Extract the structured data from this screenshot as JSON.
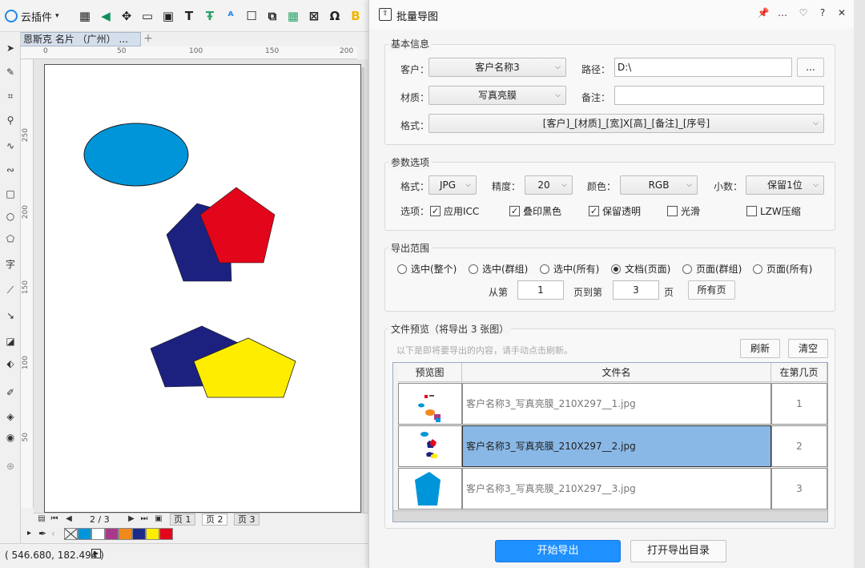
{
  "app": {
    "plugin_label": "云插件",
    "doc_tab": "恩斯克 名片 （广州） ...",
    "add_tab": "+",
    "toolbar_icons": [
      "k-logo-icon",
      "node-icon",
      "frame-icon",
      "image-icon",
      "text-tool-icon",
      "text-fit-icon",
      "figure-icon",
      "rectangle-icon",
      "copy-icon",
      "grid-icon",
      "image-edit-icon",
      "search-icon",
      "brand-icon"
    ],
    "ruler_h": [
      "0",
      "50",
      "100",
      "150",
      "200"
    ],
    "ruler_v": [
      "250",
      "200",
      "150",
      "100",
      "50"
    ],
    "pager": {
      "page_indicator": "2 / 3",
      "tabs": [
        "页 1",
        "页 2",
        "页 3"
      ],
      "active_tab": 1
    },
    "palette": [
      "#ffffff",
      "#0095d9",
      "#ffffff",
      "#a93a8a",
      "#f08a1d",
      "#1c2a8c",
      "#ffed00",
      "#e3051a"
    ],
    "status_coords": "( 546.680, 182.494 )"
  },
  "dialog": {
    "title": "批量导图",
    "title_controls": [
      "pin-icon",
      "more-icon",
      "shield-icon",
      "help-icon",
      "close-icon"
    ],
    "basic": {
      "title": "基本信息",
      "customer_label": "客户：",
      "customer_value": "客户名称3",
      "path_label": "路径：",
      "path_value": "D:\\",
      "browse_label": "...",
      "material_label": "材质：",
      "material_value": "写真亮膜",
      "note_label": "备注：",
      "note_value": "",
      "format_label": "格式：",
      "format_value": "[客户]_[材质]_[宽]X[高]_[备注]_[序号]"
    },
    "params": {
      "title": "参数选项",
      "format_label": "格式：",
      "format_value": "JPG",
      "precision_label": "精度：",
      "precision_value": "20",
      "color_label": "颜色：",
      "color_value": "RGB",
      "decimal_label": "小数：",
      "decimal_value": "保留1位",
      "options_label": "选项：",
      "options": [
        {
          "label": "应用ICC",
          "checked": true
        },
        {
          "label": "叠印黑色",
          "checked": true
        },
        {
          "label": "保留透明",
          "checked": true
        },
        {
          "label": "光滑",
          "checked": false
        },
        {
          "label": "LZW压缩",
          "checked": false
        }
      ]
    },
    "range": {
      "title": "导出范围",
      "radios": [
        {
          "label": "选中(整个)",
          "selected": false
        },
        {
          "label": "选中(群组)",
          "selected": false
        },
        {
          "label": "选中(所有)",
          "selected": false
        },
        {
          "label": "文档(页面)",
          "selected": true
        },
        {
          "label": "页面(群组)",
          "selected": false
        },
        {
          "label": "页面(所有)",
          "selected": false
        }
      ],
      "from_label": "从第",
      "from_value": "1",
      "to_label": "页到第",
      "to_value": "3",
      "page_suffix": "页",
      "all_pages_label": "所有页"
    },
    "preview": {
      "title": "文件预览（将导出 3 张图）",
      "hint": "以下是即将要导出的内容，请手动点击刷新。",
      "refresh_label": "刷新",
      "clear_label": "清空",
      "columns": [
        "预览图",
        "文件名",
        "在第几页"
      ],
      "rows": [
        {
          "file": "客户名称3_写真亮膜_210X297__1.jpg",
          "page": "1"
        },
        {
          "file": "客户名称3_写真亮膜_210X297__2.jpg",
          "page": "2"
        },
        {
          "file": "客户名称3_写真亮膜_210X297__3.jpg",
          "page": "3"
        }
      ],
      "selected_row": 1
    },
    "start_label": "开始导出",
    "open_dir_label": "打开导出目录"
  },
  "colors": {
    "primary": "#1e90ff",
    "selected_row": "#8ab8e6",
    "shape_cyan": "#0095d9",
    "shape_navy": "#1c2180",
    "shape_red": "#e3051a",
    "shape_yellow": "#ffed00"
  }
}
